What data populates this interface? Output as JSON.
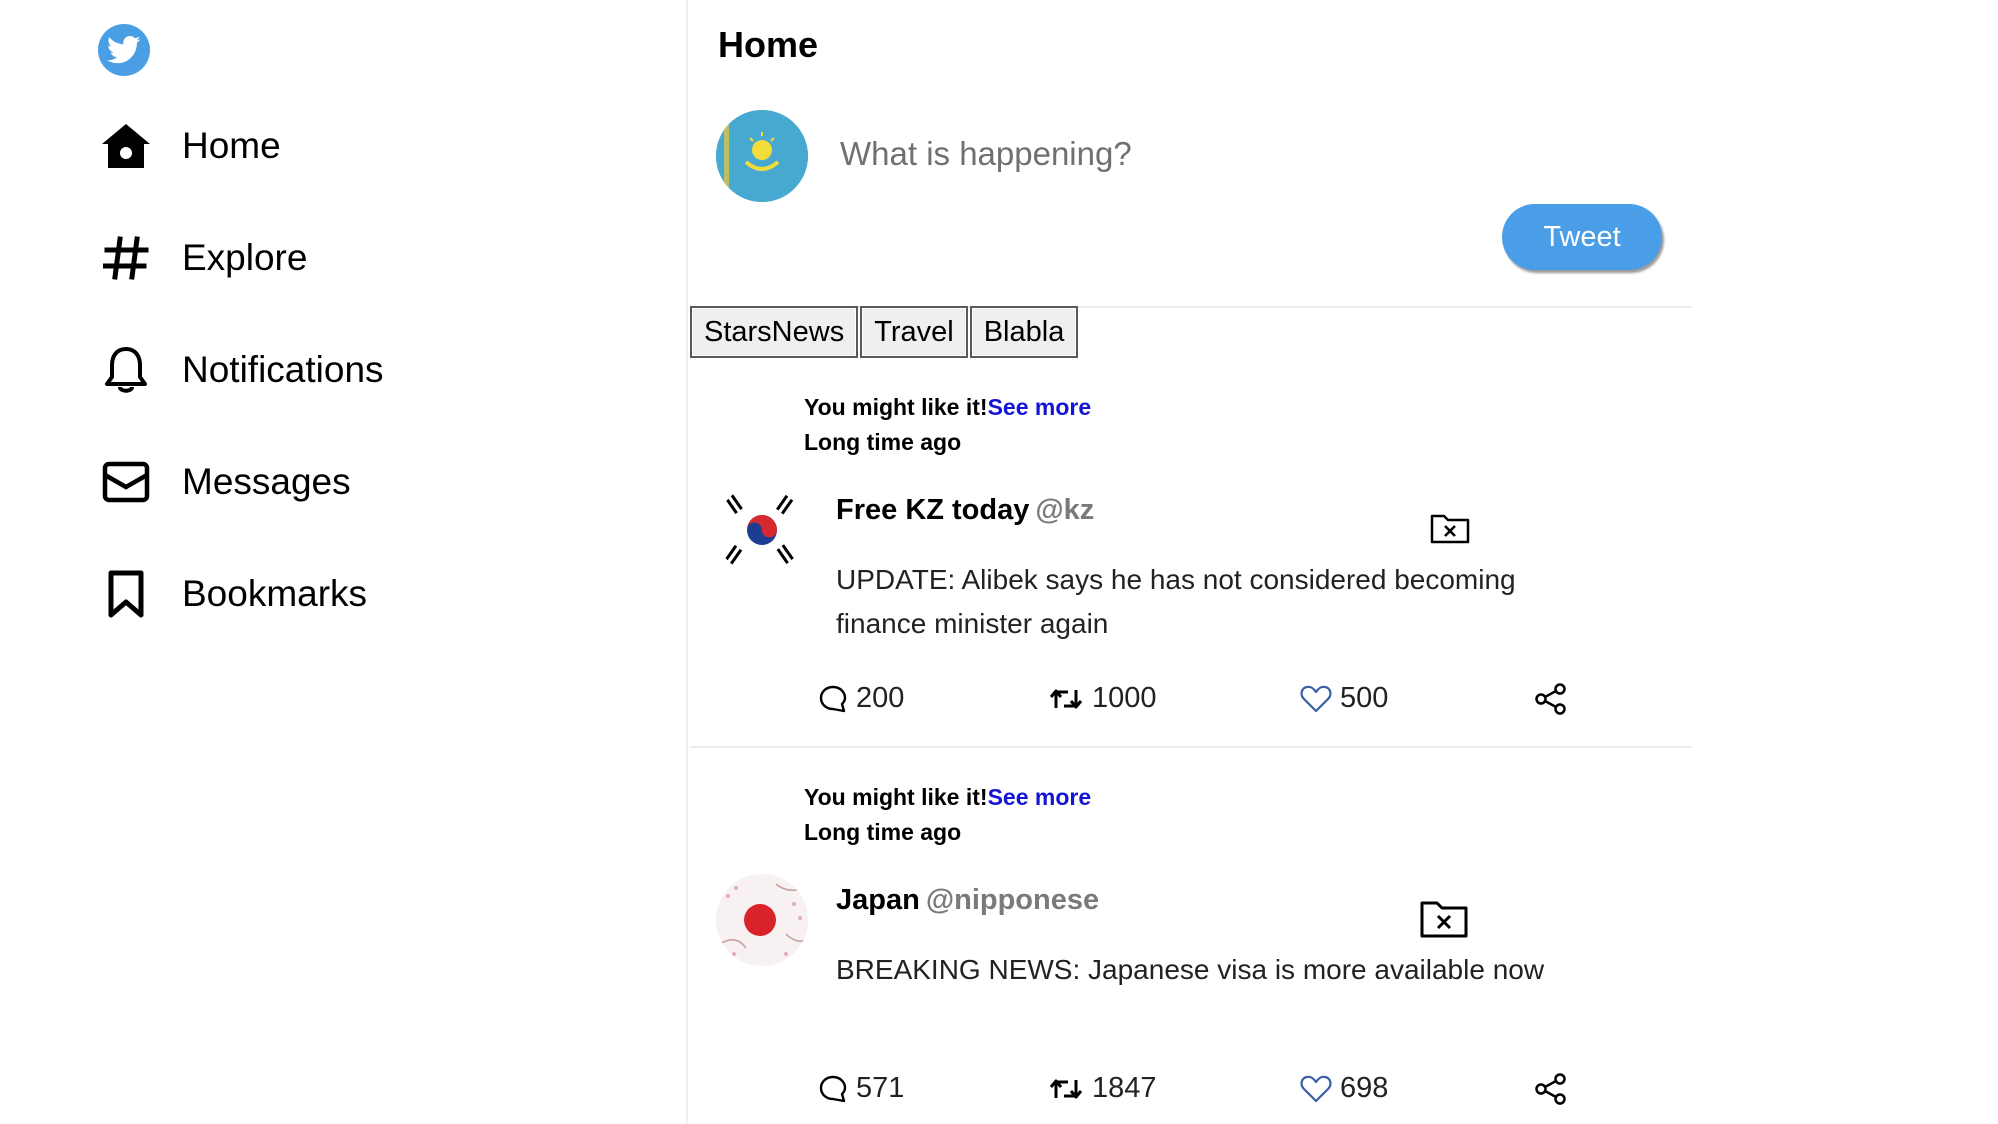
{
  "sidebar": {
    "logo_icon": "twitter-bird-icon",
    "items": [
      {
        "label": "Home",
        "icon": "home-icon"
      },
      {
        "label": "Explore",
        "icon": "hashtag-icon"
      },
      {
        "label": "Notifications",
        "icon": "bell-icon"
      },
      {
        "label": "Messages",
        "icon": "envelope-icon"
      },
      {
        "label": "Bookmarks",
        "icon": "bookmark-icon"
      }
    ]
  },
  "main": {
    "title": "Home",
    "compose": {
      "placeholder": "What is happening?",
      "tweet_button": "Tweet"
    },
    "tabs": [
      "StarsNews",
      "Travel",
      "Blabla"
    ],
    "tweets": [
      {
        "suggest_text": "You might like it!",
        "see_more": "See more",
        "time": "Long time ago",
        "name": "Free KZ today",
        "handle": "@kz",
        "text": "UPDATE: Alibek says he has not considered becoming finance minister again",
        "replies": "200",
        "retweets": "1000",
        "likes": "500"
      },
      {
        "suggest_text": "You might like it!",
        "see_more": "See more",
        "time": "Long time ago",
        "name": "Japan",
        "handle": "@nipponese",
        "text": "BREAKING NEWS: Japanese visa is more available now",
        "replies": "571",
        "retweets": "1847",
        "likes": "698"
      }
    ]
  },
  "colors": {
    "accent": "#4a9de7",
    "link": "#1414d6",
    "kz_flag": "#47a9cf"
  }
}
